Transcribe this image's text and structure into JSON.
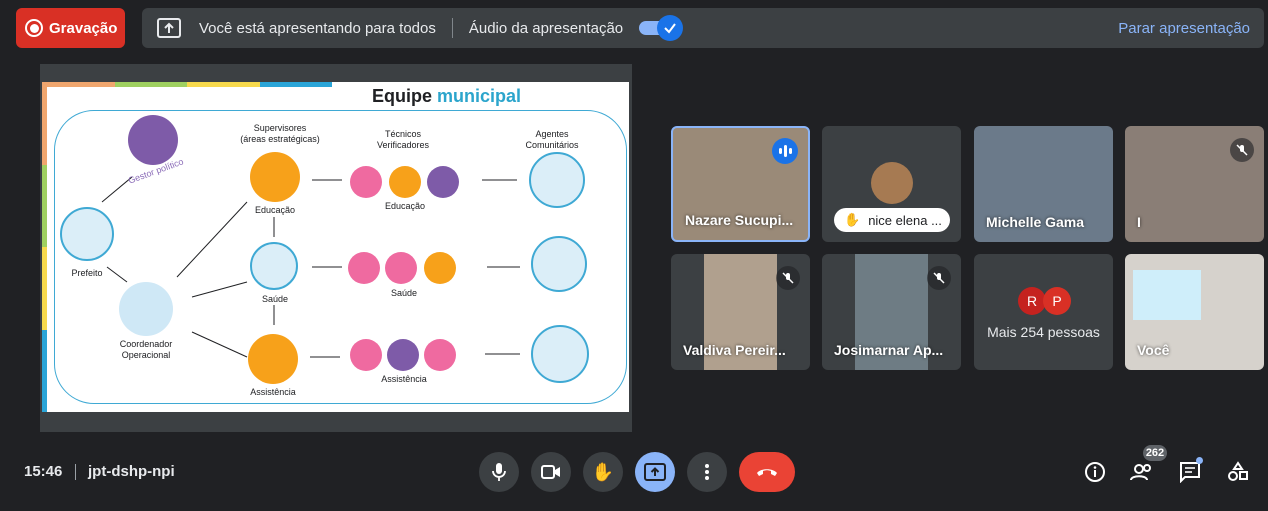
{
  "topbar": {
    "recording_label": "Gravação",
    "presenting_text": "Você está apresentando para todos",
    "audio_label": "Áudio da apresentação",
    "stop_label": "Parar apresentação"
  },
  "slide": {
    "title_plain": "Equipe ",
    "title_accent": "municipal",
    "gestor": "Gestor político",
    "prefeito": "Prefeito",
    "coordenador": "Coordenador\nOperacional",
    "supervisores": "Supervisores\n(áreas estratégicas)",
    "tecnicos": "Técnicos\nVerificadores",
    "agentes": "Agentes\nComunitários",
    "educacao": "Educação",
    "saude": "Saúde",
    "assistencia": "Assistência"
  },
  "participants": [
    {
      "name": "Nazare Sucupi...",
      "speaking": true
    },
    {
      "name": "nice elena ..."
    },
    {
      "name": "Michelle Gama"
    },
    {
      "name": "I",
      "muted": true
    },
    {
      "name": "Valdiva Pereir...",
      "muted": true
    },
    {
      "name": "Josimarnar Ap...",
      "muted": true
    },
    {
      "name": "Mais 254 pessoas",
      "initials": [
        "R",
        "P"
      ]
    },
    {
      "name": "Você"
    }
  ],
  "bottom": {
    "time": "15:46",
    "meeting_code": "jpt-dshp-npi",
    "people_count": "262"
  },
  "colors": {
    "accent": "#8ab4f8",
    "end_call": "#ea4335",
    "recording": "#d93025"
  }
}
